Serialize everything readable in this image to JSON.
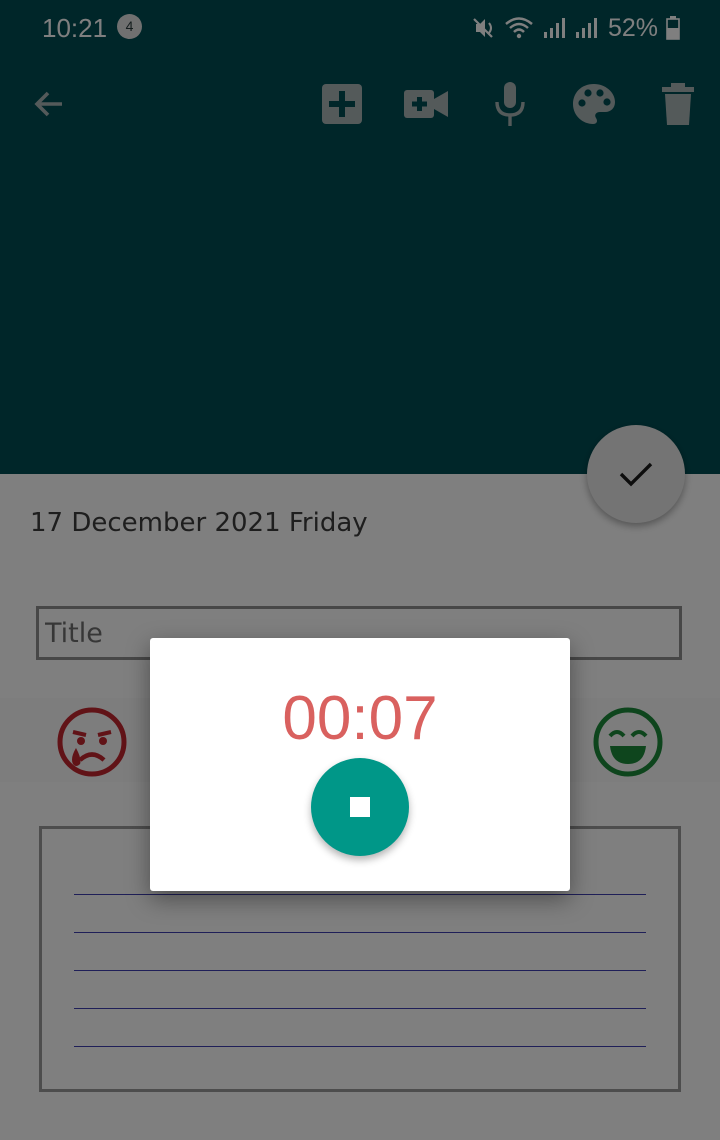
{
  "status_bar": {
    "time": "10:21",
    "notification_count": "4",
    "battery": "52%"
  },
  "toolbar": {
    "icons": [
      "back-arrow-icon",
      "add-box-icon",
      "video-camera-icon",
      "microphone-icon",
      "palette-icon",
      "trash-icon"
    ]
  },
  "note": {
    "date": "17 December 2021 Friday",
    "title_placeholder": "Title",
    "moods": [
      "sad-face-icon",
      "happy-face-icon"
    ]
  },
  "recorder": {
    "elapsed": "00:07"
  },
  "colors": {
    "header": "#004d53",
    "toolbar_icon": "#a9b4b5",
    "timer_text": "#d9615f",
    "stop_button": "#009788",
    "mood_sad": "#c3262f",
    "mood_happy": "#1d8a3b",
    "note_lines": "#3f3fb0"
  }
}
